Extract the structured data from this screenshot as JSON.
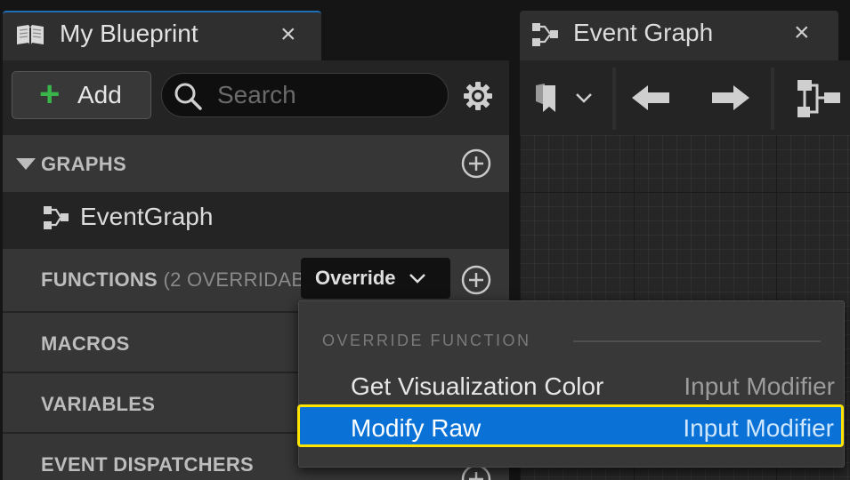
{
  "left_tab": {
    "title": "My Blueprint",
    "icon": "blueprint-book-icon",
    "close": "×"
  },
  "toolbar": {
    "add_label": "Add",
    "search_placeholder": "Search",
    "settings_icon": "gear-icon"
  },
  "sections": {
    "graphs": {
      "label": "GRAPHS",
      "items": [
        {
          "label": "EventGraph",
          "icon": "graph-icon"
        }
      ]
    },
    "functions": {
      "label": "FUNCTIONS",
      "overridable": "(2 OVERRIDAB",
      "override_button": "Override"
    },
    "macros": {
      "label": "MACROS"
    },
    "variables": {
      "label": "VARIABLES"
    },
    "dispatchers": {
      "label": "EVENT DISPATCHERS"
    }
  },
  "right_tab": {
    "title": "Event Graph",
    "icon": "graph-icon",
    "close": "×"
  },
  "graph_toolbar": {
    "icons": [
      "bookmark-icon",
      "back-arrow-icon",
      "forward-arrow-icon",
      "hierarchy-icon"
    ]
  },
  "override_menu": {
    "heading": "OVERRIDE FUNCTION",
    "items": [
      {
        "name": "Get Visualization Color",
        "context": "Input Modifier",
        "selected": false
      },
      {
        "name": "Modify Raw",
        "context": "Input Modifier",
        "selected": true
      }
    ]
  },
  "colors": {
    "accent_blue": "#0a72d6",
    "focus_yellow": "#ffe400",
    "add_green": "#39b54a",
    "panel": "#242424",
    "section": "#363636"
  }
}
